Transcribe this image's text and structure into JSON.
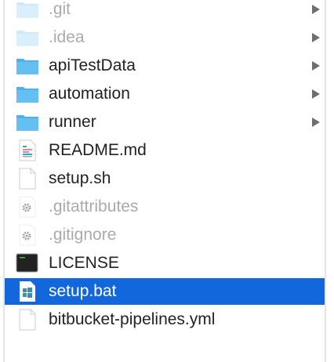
{
  "items": [
    {
      "name": ".git",
      "kind": "folder",
      "dim": true,
      "expandable": true
    },
    {
      "name": ".idea",
      "kind": "folder",
      "dim": true,
      "expandable": true
    },
    {
      "name": "apiTestData",
      "kind": "folder",
      "dim": false,
      "expandable": true
    },
    {
      "name": "automation",
      "kind": "folder",
      "dim": false,
      "expandable": true
    },
    {
      "name": "runner",
      "kind": "folder",
      "dim": false,
      "expandable": true
    },
    {
      "name": "README.md",
      "kind": "markdown",
      "dim": false,
      "expandable": false
    },
    {
      "name": "setup.sh",
      "kind": "doc",
      "dim": false,
      "expandable": false
    },
    {
      "name": ".gitattributes",
      "kind": "config",
      "dim": true,
      "expandable": false
    },
    {
      "name": ".gitignore",
      "kind": "config",
      "dim": true,
      "expandable": false
    },
    {
      "name": "LICENSE",
      "kind": "terminal",
      "dim": false,
      "expandable": false
    },
    {
      "name": "setup.bat",
      "kind": "windows",
      "dim": false,
      "expandable": false,
      "selected": true
    },
    {
      "name": "bitbucket-pipelines.yml",
      "kind": "doc",
      "dim": false,
      "expandable": false
    }
  ],
  "colors": {
    "selection": "#1367dd",
    "folder": "#5ab8ee"
  }
}
